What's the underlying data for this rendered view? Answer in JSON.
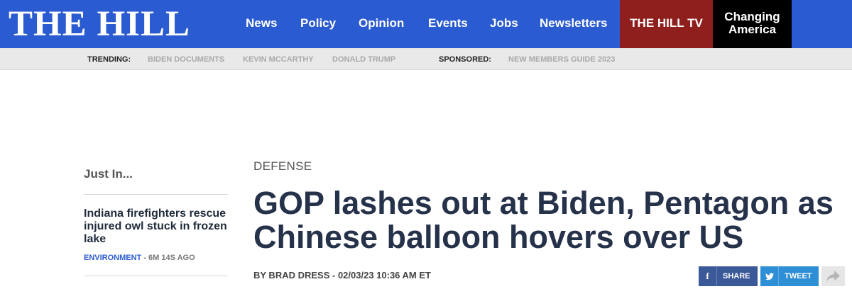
{
  "site": {
    "logo": "THE HILL"
  },
  "nav": {
    "items": [
      "News",
      "Policy",
      "Opinion",
      "Events",
      "Jobs",
      "Newsletters"
    ],
    "tv_label": "THE HILL TV",
    "changing_line1": "Changing",
    "changing_line2": "America"
  },
  "trending": {
    "label": "TRENDING:",
    "items": [
      "BIDEN DOCUMENTS",
      "KEVIN MCCARTHY",
      "DONALD TRUMP"
    ],
    "sponsored_label": "SPONSORED:",
    "sponsored_item": "NEW MEMBERS GUIDE 2023"
  },
  "sidebar": {
    "title": "Just In...",
    "story": {
      "headline": "Indiana firefighters rescue injured owl stuck in frozen lake",
      "category": "ENVIRONMENT",
      "time": " - 6M 14S AGO"
    }
  },
  "article": {
    "section": "DEFENSE",
    "headline": "GOP lashes out at Biden, Pentagon as Chinese balloon hovers over US",
    "author": "BY BRAD DRESS",
    "date": " - 02/03/23 10:36 AM ET"
  },
  "share": {
    "facebook_label": "SHARE",
    "twitter_label": "TWEET",
    "icons": [
      "facebook-icon",
      "twitter-icon",
      "share-arrow-icon"
    ]
  },
  "colors": {
    "nav_blue": "#2b5bd0",
    "tv_red": "#8e1f1d",
    "facebook": "#3b5998",
    "twitter": "#2f8fd6",
    "headline": "#26324a"
  }
}
